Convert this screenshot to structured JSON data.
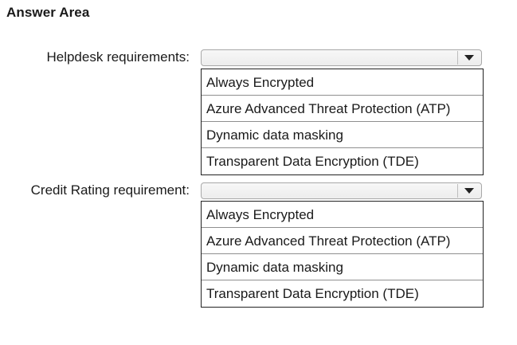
{
  "header": "Answer Area",
  "groups": [
    {
      "label": "Helpdesk requirements:",
      "selected_value": "",
      "options": [
        "Always Encrypted",
        "Azure Advanced Threat Protection (ATP)",
        "Dynamic data masking",
        "Transparent Data Encryption (TDE)"
      ]
    },
    {
      "label": "Credit Rating requirement:",
      "selected_value": "",
      "options": [
        "Always Encrypted",
        "Azure Advanced Threat Protection (ATP)",
        "Dynamic data masking",
        "Transparent Data Encryption (TDE)"
      ]
    }
  ],
  "icons": {
    "dropdown": "chevron-down-icon"
  }
}
